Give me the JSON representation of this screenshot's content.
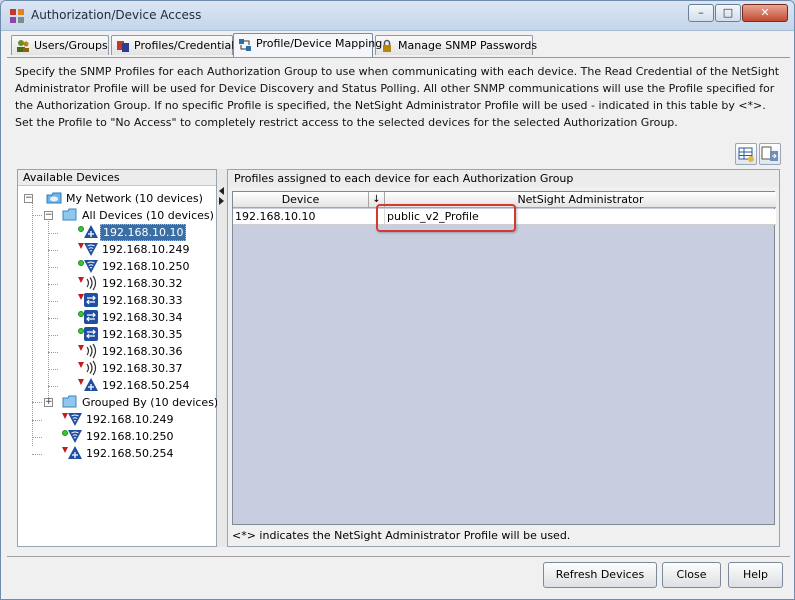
{
  "window": {
    "title": "Authorization/Device Access",
    "controls": {
      "minimize": "–",
      "maximize": "□",
      "close": "✕"
    }
  },
  "tabs": [
    {
      "label": "Users/Groups",
      "icon": "users-icon",
      "active": false
    },
    {
      "label": "Profiles/Credentials",
      "icon": "profiles-icon",
      "active": false
    },
    {
      "label": "Profile/Device Mapping",
      "icon": "mapping-icon",
      "active": true
    },
    {
      "label": "Manage SNMP Passwords",
      "icon": "lock-icon",
      "active": false
    }
  ],
  "description": "Specify the SNMP Profiles for each Authorization Group to use when communicating with each device.  The Read Credential of the NetSight Administrator Profile will be used for Device Discovery and Status Polling.  All other SNMP communications will use the Profile specified for the Authorization Group.  If no specific Profile is specified, the NetSight Administrator Profile will be used - indicated in this table by <*>.  Set the Profile to \"No Access\" to completely restrict access to the selected devices for the selected Authorization Group.",
  "left_panel": {
    "header": "Available Devices",
    "tree": {
      "root": "My Network (10 devices)",
      "all_devices": "All Devices (10 devices)",
      "devices": [
        {
          "ip": "192.168.10.10",
          "icon": "router-icon",
          "status": "up",
          "selected": true
        },
        {
          "ip": "192.168.10.249",
          "icon": "wireless-icon",
          "status": "down"
        },
        {
          "ip": "192.168.10.250",
          "icon": "wireless-icon",
          "status": "up"
        },
        {
          "ip": "192.168.30.32",
          "icon": "access-point-icon",
          "status": "down"
        },
        {
          "ip": "192.168.30.33",
          "icon": "switch-icon",
          "status": "down"
        },
        {
          "ip": "192.168.30.34",
          "icon": "switch-icon",
          "status": "up"
        },
        {
          "ip": "192.168.30.35",
          "icon": "switch-icon",
          "status": "up"
        },
        {
          "ip": "192.168.30.36",
          "icon": "access-point-icon",
          "status": "down"
        },
        {
          "ip": "192.168.30.37",
          "icon": "access-point-icon",
          "status": "down"
        },
        {
          "ip": "192.168.50.254",
          "icon": "router-icon",
          "status": "down"
        }
      ],
      "grouped_by": "Grouped By (10 devices)",
      "extra": [
        {
          "ip": "192.168.10.249",
          "icon": "wireless-icon",
          "status": "down"
        },
        {
          "ip": "192.168.10.250",
          "icon": "wireless-icon",
          "status": "up"
        },
        {
          "ip": "192.168.50.254",
          "icon": "router-icon",
          "status": "down"
        }
      ]
    }
  },
  "right_panel": {
    "header": "Profiles assigned to each device for each Authorization Group",
    "columns": [
      "Device",
      "NetSight Administrator"
    ],
    "sort_indicator": "↓",
    "rows": [
      {
        "device": "192.168.10.10",
        "profile": "public_v2_Profile"
      }
    ],
    "footnote": "<*> indicates the NetSight Administrator Profile will be used."
  },
  "buttons": {
    "refresh": "Refresh Devices",
    "close": "Close",
    "help": "Help"
  },
  "colors": {
    "selection": "#3a6ea5",
    "highlight_border": "#d23a2f",
    "status_up": "#3bc43b",
    "status_down": "#c21d1d"
  }
}
